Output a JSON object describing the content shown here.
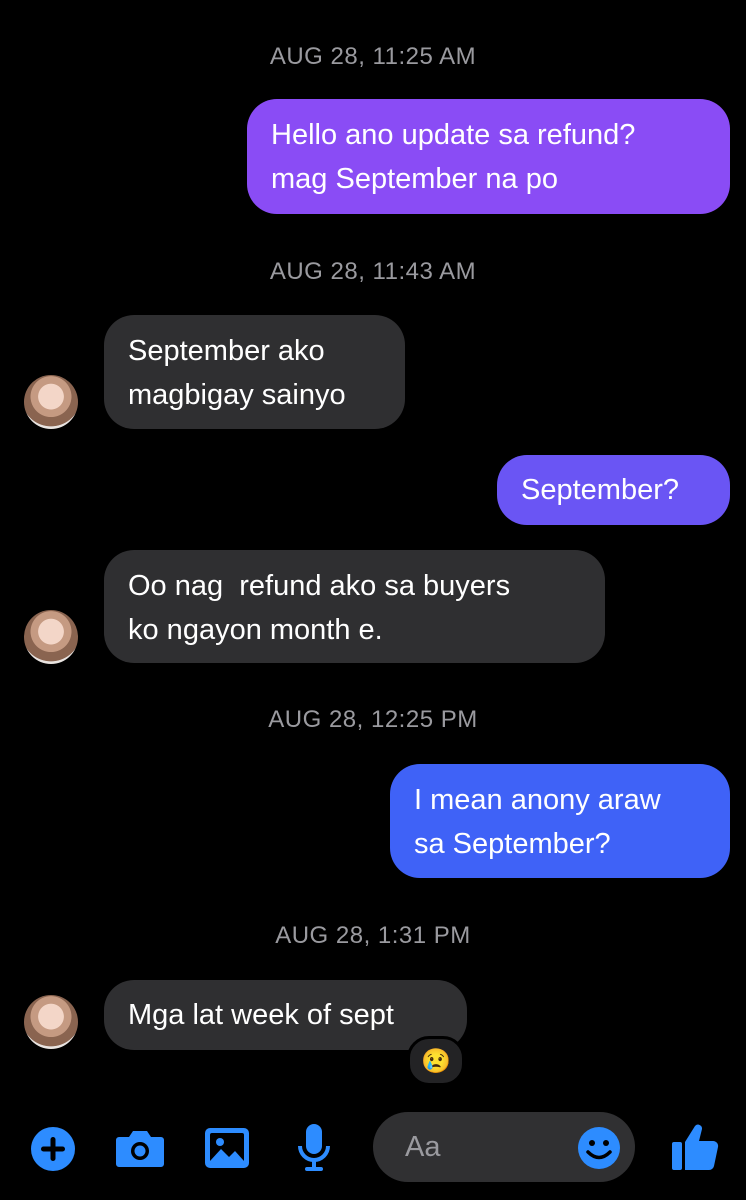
{
  "thread": {
    "timestamps": [
      "AUG 28, 11:25 AM",
      "AUG 28, 11:43 AM",
      "AUG 28, 12:25 PM",
      "AUG 28, 1:31 PM"
    ],
    "messages": [
      {
        "from": "me",
        "text": "Hello ano update sa refund?\nmag September na po",
        "color": "#8a4cf5"
      },
      {
        "from": "them",
        "text": "September ako\nmagbigay sainyo"
      },
      {
        "from": "me",
        "text": "September?",
        "color": "#6a55f4"
      },
      {
        "from": "them",
        "text": "Oo nag  refund ako sa buyers\nko ngayon month e."
      },
      {
        "from": "me",
        "text": "I mean anony araw\nsa September?",
        "color": "#3f62f7"
      },
      {
        "from": "them",
        "text": "Mga lat week of sept",
        "reaction": "😢"
      }
    ]
  },
  "composer": {
    "placeholder": "Aa",
    "accent": "#2d8cff",
    "icons": [
      "plus-icon",
      "camera-icon",
      "image-icon",
      "mic-icon",
      "emoji-icon",
      "thumbs-up-icon"
    ]
  }
}
